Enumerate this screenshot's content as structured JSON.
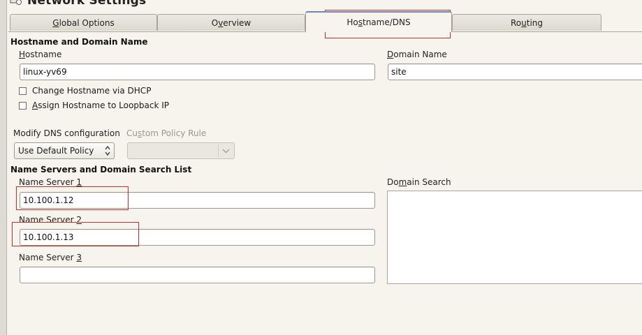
{
  "window": {
    "title": "Network Settings"
  },
  "tabs": [
    {
      "label": "Global Options",
      "mnemonic_prefix": "",
      "mnemonic_char": "G",
      "rest": "lobal Options"
    },
    {
      "label": "Overview",
      "mnemonic_prefix": "O",
      "mnemonic_char": "v",
      "rest": "erview"
    },
    {
      "label": "Hostname/DNS",
      "mnemonic_prefix": "Ho",
      "mnemonic_char": "s",
      "rest": "tname/DNS"
    },
    {
      "label": "Routing",
      "mnemonic_prefix": "Ro",
      "mnemonic_char": "u",
      "rest": "ting"
    }
  ],
  "active_tab": "Hostname/DNS",
  "hostname_section": {
    "title": "Hostname and Domain Name",
    "hostname_label": {
      "prefix": "",
      "char": "H",
      "rest": "ostname"
    },
    "hostname_value": "linux-yv69",
    "domain_label": {
      "prefix": "",
      "char": "D",
      "rest": "omain Name"
    },
    "domain_value": "site",
    "change_hostname_dhcp": {
      "prefix": "Chan",
      "char": "g",
      "rest": "e Hostname via DHCP",
      "checked": false
    },
    "assign_loopback": {
      "prefix": "",
      "char": "A",
      "rest": "ssign Hostname to Loopback IP",
      "checked": false
    }
  },
  "dns_config": {
    "modify_label": {
      "prefix": "Modify DNS configuration",
      "char": "",
      "rest": ""
    },
    "modify_value": "Use Default Policy",
    "custom_policy_label": {
      "prefix": "Cu",
      "char": "s",
      "rest": "tom Policy Rule"
    },
    "custom_policy_value": ""
  },
  "name_servers_section": {
    "title": "Name Servers and Domain Search List",
    "ns1_label": {
      "prefix": "Name Server ",
      "char": "1",
      "rest": ""
    },
    "ns1_value": "10.100.1.12",
    "ns2_label": {
      "prefix": "Name Server ",
      "char": "2",
      "rest": ""
    },
    "ns2_value": "10.100.1.13",
    "ns3_label": {
      "prefix": "Name Server ",
      "char": "3",
      "rest": ""
    },
    "ns3_value": "",
    "domain_search_label": {
      "prefix": "Do",
      "char": "m",
      "rest": "ain Search"
    }
  },
  "colors": {
    "highlight": "#d12b2b",
    "active_tab_top": "#6a88b3"
  }
}
